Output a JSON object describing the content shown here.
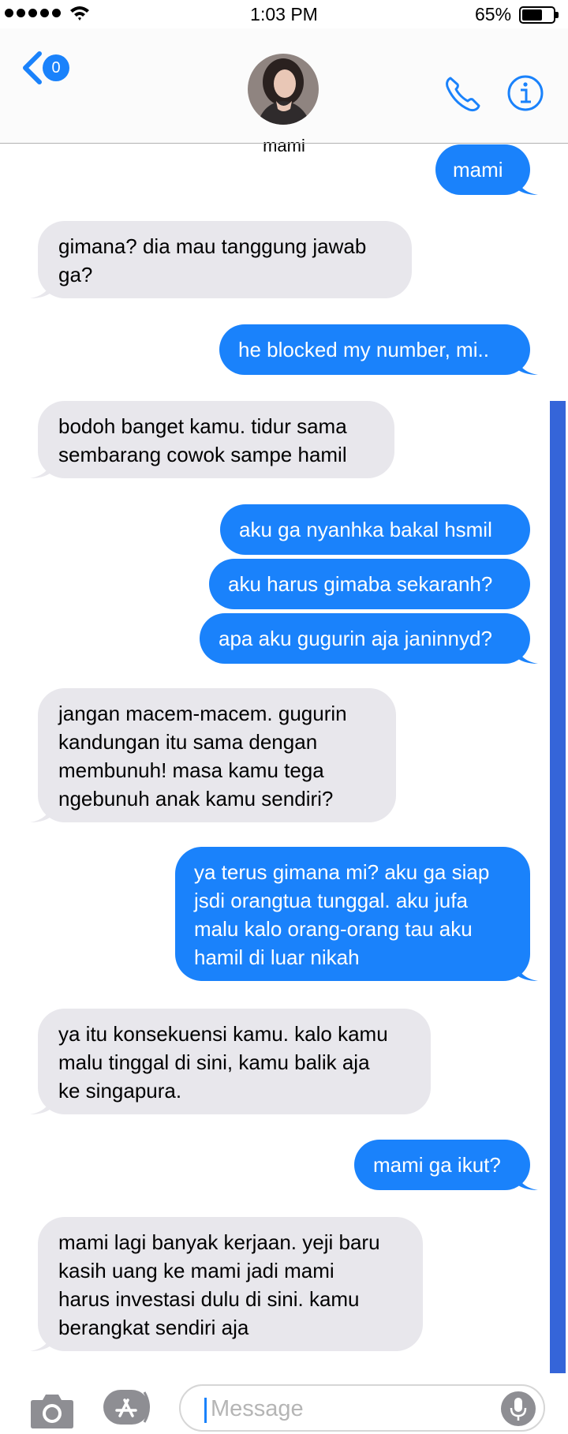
{
  "status_bar": {
    "time": "1:03 PM",
    "battery_percent": "65%",
    "battery_level": 0.65
  },
  "header": {
    "back_badge_count": "0",
    "contact_name": "mami"
  },
  "messages": [
    {
      "from": "me",
      "text": "mami"
    },
    {
      "from": "contact",
      "text": "gimana? dia mau tanggung jawab\nga?"
    },
    {
      "from": "me",
      "text": "he blocked my number, mi.."
    },
    {
      "from": "contact",
      "text": "bodoh banget kamu. tidur sama\nsembarang cowok sampe hamil"
    },
    {
      "from": "me",
      "text": "aku ga nyanhka bakal hsmil"
    },
    {
      "from": "me",
      "text": "aku harus gimaba sekaranh?"
    },
    {
      "from": "me",
      "text": "apa aku gugurin aja janinnyd?"
    },
    {
      "from": "contact",
      "text": "jangan macem-macem. gugurin\nkandungan itu sama dengan\nmembunuh! masa kamu tega\nngebunuh anak kamu sendiri?"
    },
    {
      "from": "me",
      "text": "ya terus gimana mi? aku ga siap\njsdi orangtua tunggal. aku jufa\nmalu kalo orang-orang tau aku\nhamil di luar nikah"
    },
    {
      "from": "contact",
      "text": "ya itu konsekuensi kamu. kalo kamu\nmalu tinggal di sini, kamu balik aja\nke singapura."
    },
    {
      "from": "me",
      "text": "mami ga ikut?"
    },
    {
      "from": "contact",
      "text": "mami lagi banyak kerjaan. yeji baru\nkasih uang ke mami jadi mami\nharus investasi dulu di sini. kamu\nberangkat sendiri aja"
    }
  ],
  "compose": {
    "placeholder": "Message"
  },
  "icons": [
    "back-chevron-icon",
    "call-icon",
    "info-icon",
    "camera-icon",
    "app-store-icon",
    "microphone-icon"
  ],
  "colors": {
    "sent_bubble": "#1a82fb",
    "received_bubble": "#e8e7ec",
    "accent": "#1a82fb",
    "scroll_indicator": "#3565d9"
  }
}
